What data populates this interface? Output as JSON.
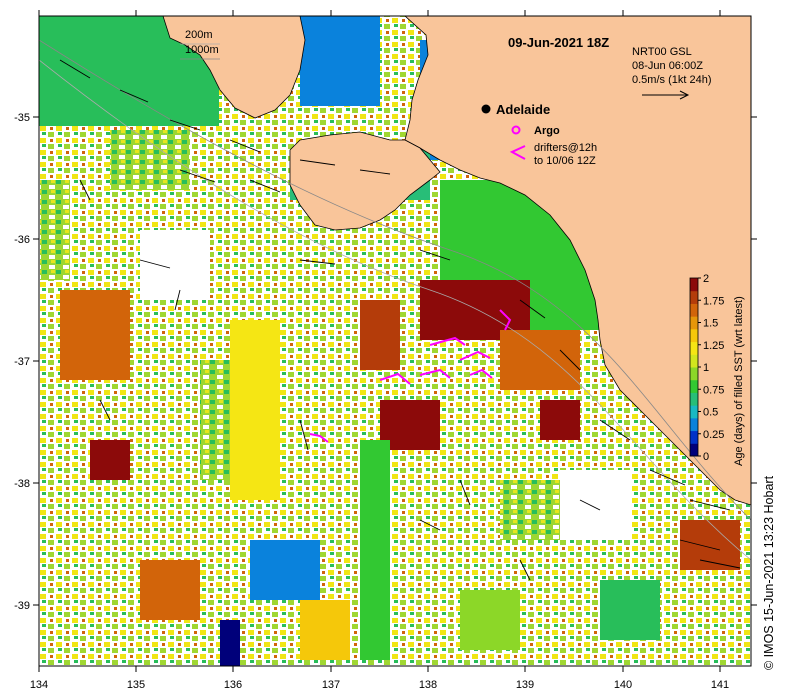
{
  "map": {
    "title": "09-Jun-2021 18Z",
    "product": "NRT00 GSL",
    "product_time": "08-Jun 06:00Z",
    "velocity_scale": "0.5m/s (1kt 24h)",
    "isobath_labels": [
      "200m",
      "1000m"
    ],
    "place_label": "Adelaide",
    "argo_label": "Argo",
    "drifters_label_1": "drifters@12h",
    "drifters_label_2": "to 10/06 12Z",
    "credit": "© IMOS 15-Jun-2021 13:23 Hobart",
    "land_color": "#f9c59a",
    "argo_color": "#ff00ff",
    "drifter_color": "#ff00ff"
  },
  "axes": {
    "x_ticks": [
      "134",
      "135",
      "136",
      "137",
      "138",
      "139",
      "140",
      "141"
    ],
    "y_ticks": [
      "-35",
      "-36",
      "-37",
      "-38",
      "-39"
    ],
    "x_range": [
      134,
      141.3
    ],
    "y_range": [
      -39.5,
      -34.1
    ]
  },
  "colorbar": {
    "label": "Age (days) of filled SST (wrt latest)",
    "ticks": [
      "2",
      "1.75",
      "1.5",
      "1.25",
      "1",
      "0.75",
      "0.5",
      "0.25",
      "0"
    ],
    "range": [
      0,
      2
    ],
    "colors": [
      "#00007a",
      "#0032c8",
      "#0a82dc",
      "#19b9c3",
      "#28be78",
      "#32c832",
      "#8cd728",
      "#d2e61e",
      "#f5e614",
      "#f5c80a",
      "#e6960a",
      "#d2640a",
      "#b43c0a",
      "#8c0a0a"
    ]
  },
  "locations": [
    {
      "name": "Adelaide",
      "lon": 138.6,
      "lat": -34.93
    }
  ]
}
